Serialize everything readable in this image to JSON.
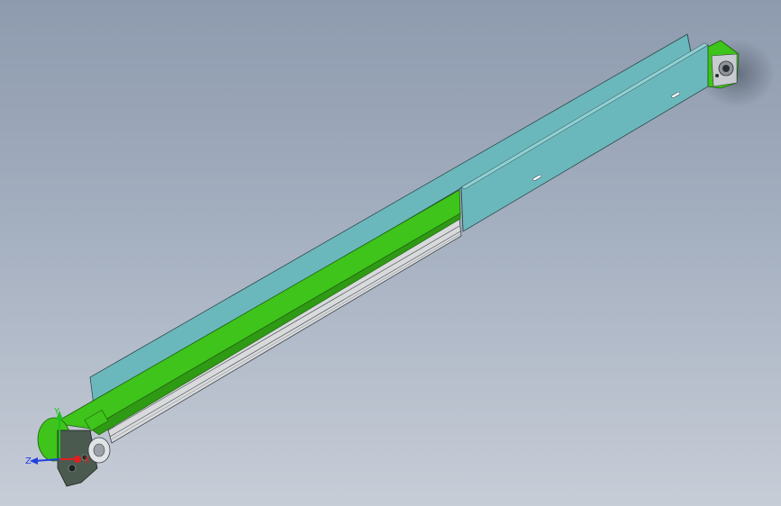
{
  "triad": {
    "x_label": "X",
    "y_label": "Y",
    "z_label": "Z"
  },
  "colors": {
    "background_top": "#8e9bae",
    "background_bottom": "#c7cdd7",
    "side_plate": "#6bb8bc",
    "belt": "#3ec41a",
    "aluminum_profile": "#d8dadc",
    "end_bracket": "#4b5a4f",
    "triad_x": "#e02020",
    "triad_y": "#20c020",
    "triad_z": "#2040e0"
  }
}
